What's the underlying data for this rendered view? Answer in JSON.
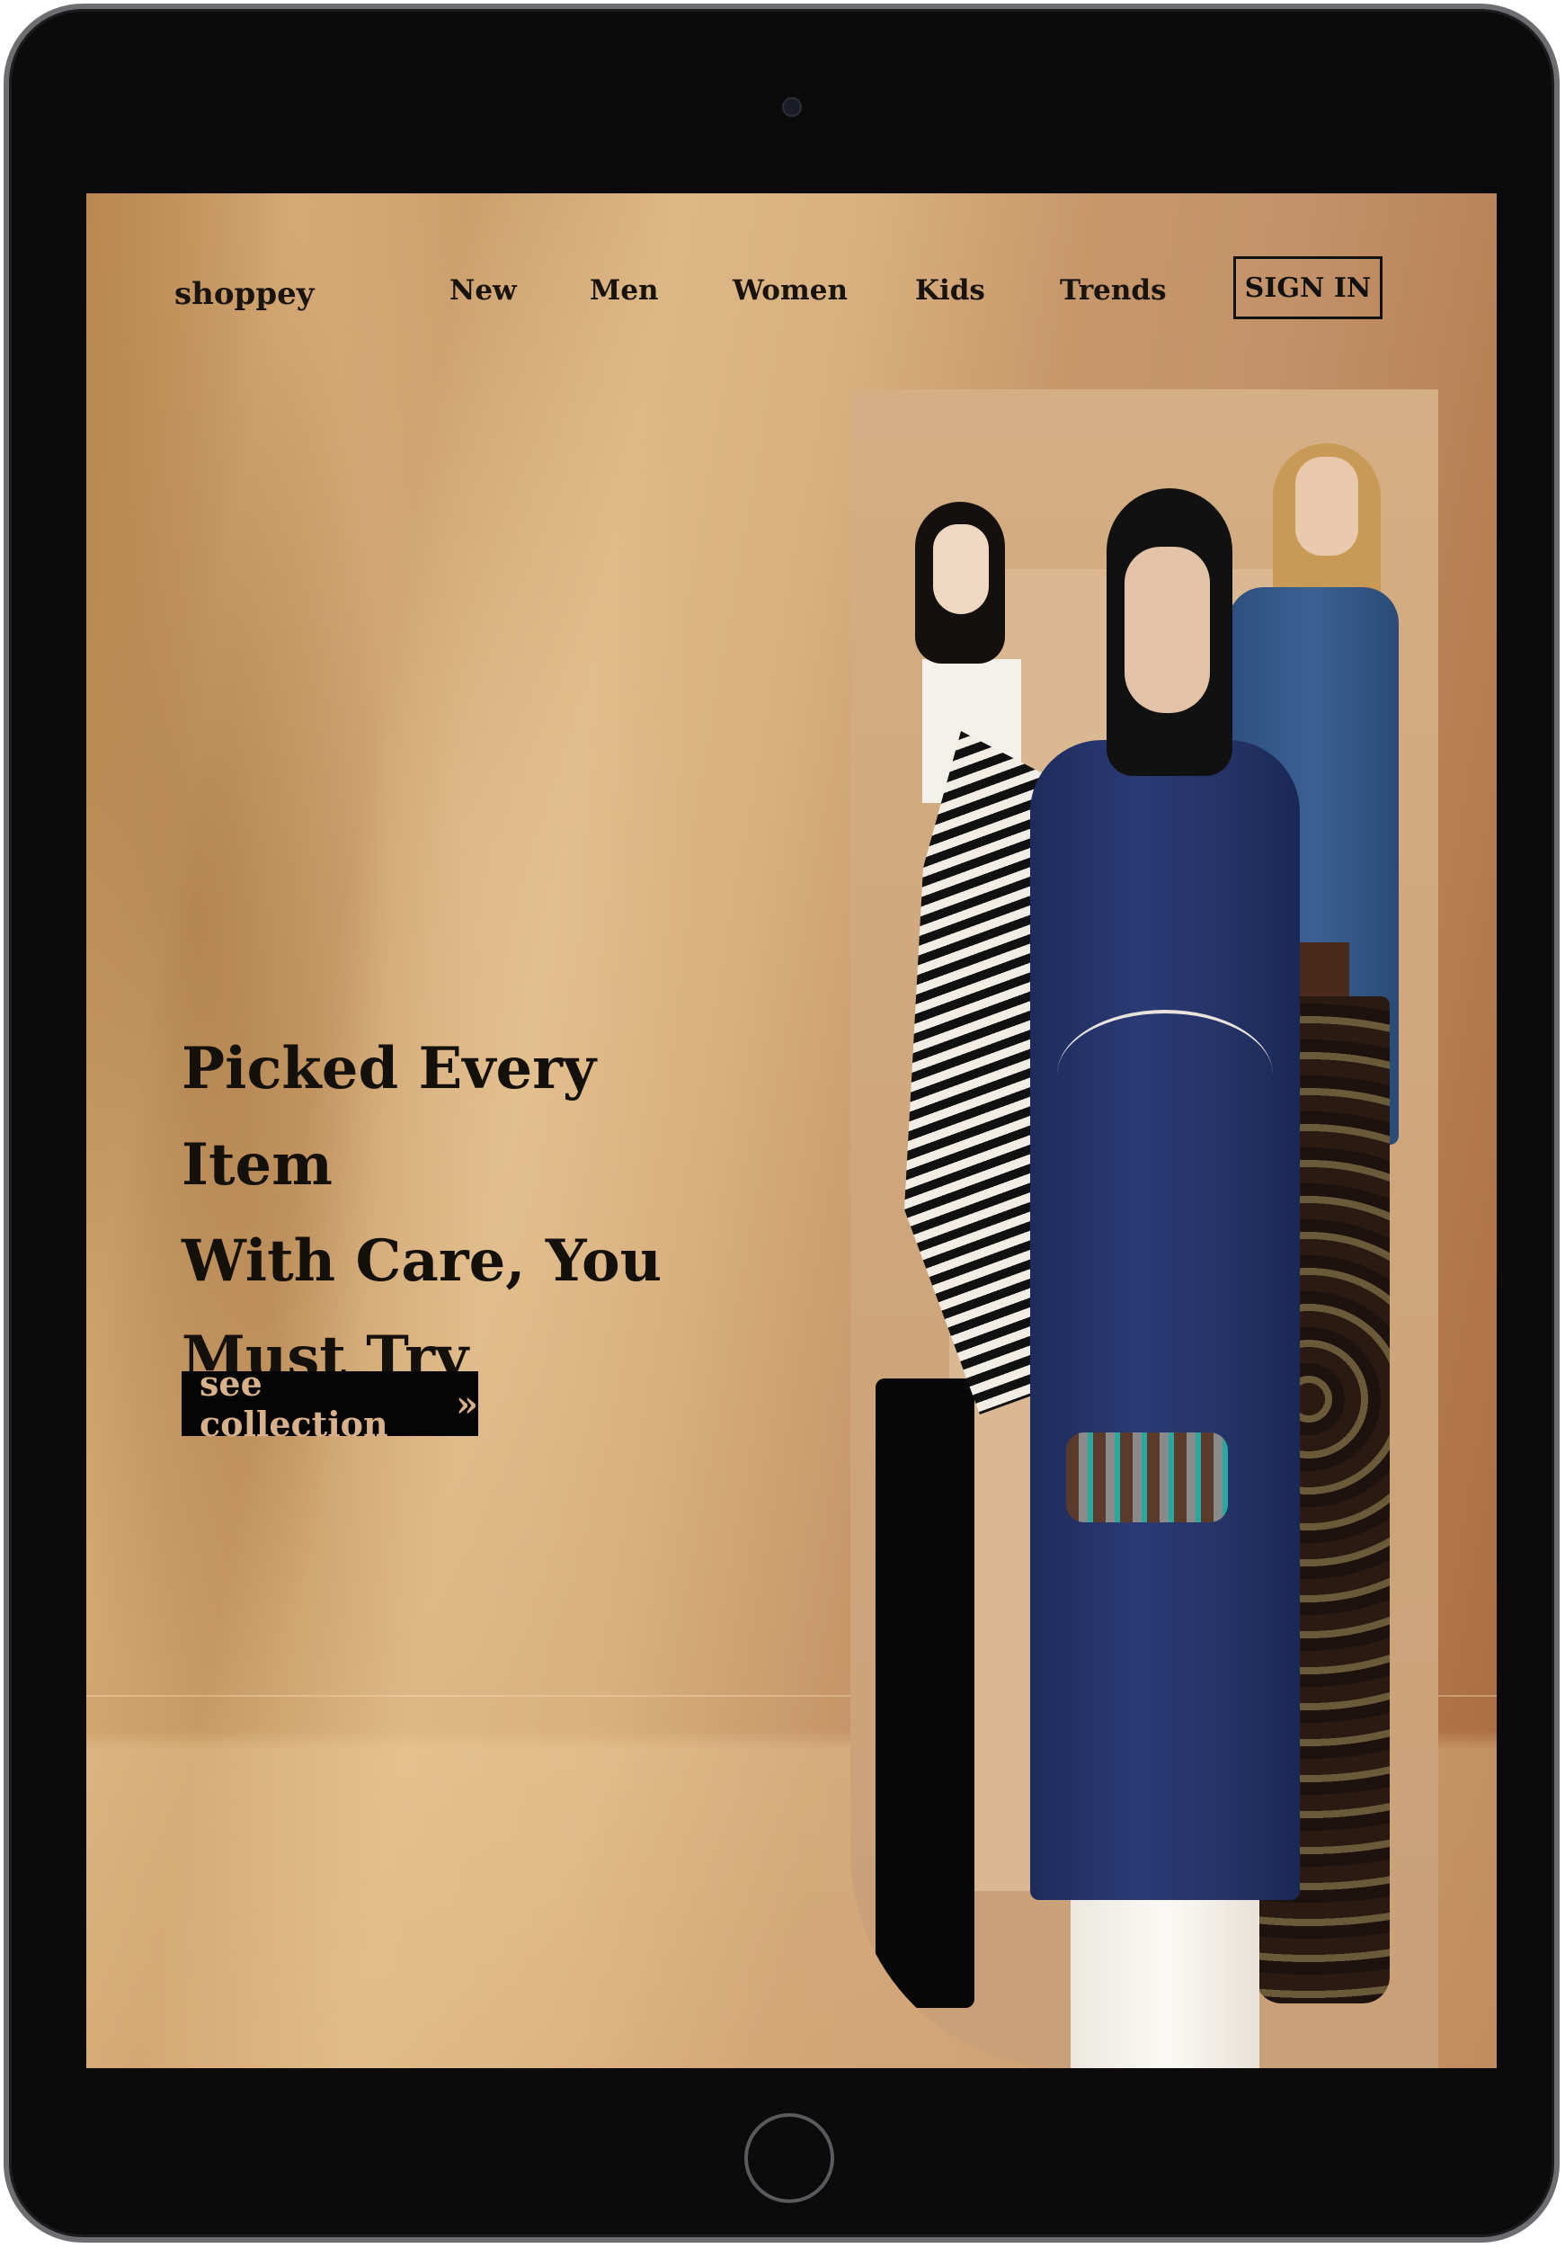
{
  "nav": {
    "logo": "shoppey",
    "links": [
      "New",
      "Men",
      "Women",
      "Kids",
      "Trends"
    ],
    "sign_in": "SIGN IN"
  },
  "hero": {
    "title_lines": [
      "Picked Every Item",
      "With Care, You",
      "Must Try"
    ],
    "cta_label": "see collection",
    "cta_icon": "double-chevron-right-icon"
  },
  "image": {
    "description_icon": "fashion-models-photo"
  },
  "colors": {
    "background_warm": "#c89a66",
    "text_dark": "#1a1410",
    "cta_bg": "#050505",
    "cta_text": "#d8b08a"
  }
}
